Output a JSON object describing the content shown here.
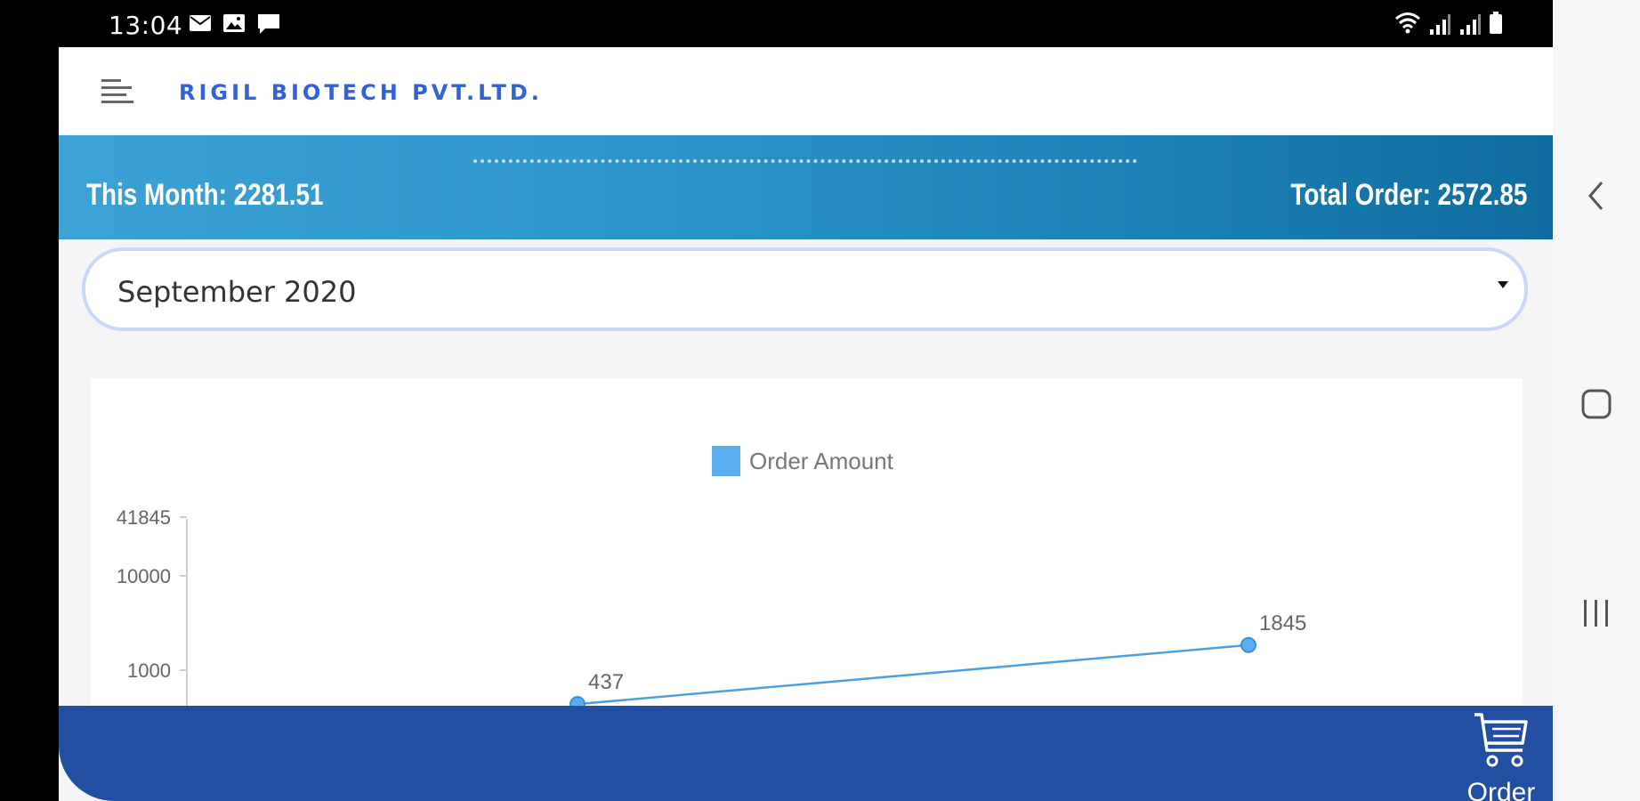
{
  "status_bar": {
    "time": "13:04",
    "notification_icons": [
      "mail-icon",
      "image-icon",
      "message-icon"
    ],
    "system_icons": [
      "wifi-icon",
      "signal-icon",
      "signal-icon",
      "battery-icon"
    ]
  },
  "app": {
    "brand": "RIGIL BIOTECH PVT.LTD.",
    "summary": {
      "this_month": "This Month: 2281.51",
      "total_order": "Total Order: 2572.85"
    },
    "month_select": {
      "selected": "September 2020"
    },
    "bottom_bar": {
      "order_label": "Order"
    }
  },
  "colors": {
    "brand_blue": "#2f63d6",
    "summary_start": "#3da2d6",
    "summary_end": "#0f6c9f",
    "bottom_bar": "#234fa3",
    "series": "#4a9fe3"
  },
  "chart_data": {
    "type": "line",
    "legend": [
      "Order Amount"
    ],
    "y_scale": "log",
    "y_ticks": [
      "41845",
      "10000",
      "1000"
    ],
    "series": [
      {
        "name": "Order Amount",
        "points": [
          {
            "x": 0,
            "y": 437,
            "label": "437"
          },
          {
            "x": 1,
            "y": 1845,
            "label": "1845"
          }
        ]
      }
    ]
  }
}
